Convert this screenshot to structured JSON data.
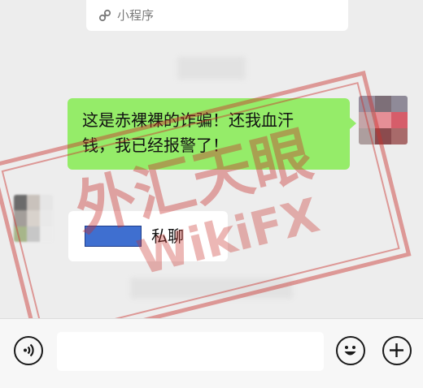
{
  "mini_program": {
    "label": "小程序",
    "icon": "mini-program-icon"
  },
  "messages": {
    "outgoing": {
      "line1": "这是赤裸裸的诈骗！还我血汗",
      "line2": "钱，我已经报警了！"
    },
    "incoming": {
      "text": "私聊"
    }
  },
  "watermark": {
    "cjk": "外汇天眼",
    "latin": "WikiFX",
    "color": "#c9302c"
  },
  "toolbar": {
    "voice_icon": "voice-icon",
    "emoji_icon": "emoji-icon",
    "plus_icon": "plus-icon",
    "input_value": ""
  },
  "colors": {
    "bubble_out": "#95ec69",
    "bubble_in": "#ffffff",
    "background": "#ededed",
    "redaction": "#3f6fd0"
  }
}
